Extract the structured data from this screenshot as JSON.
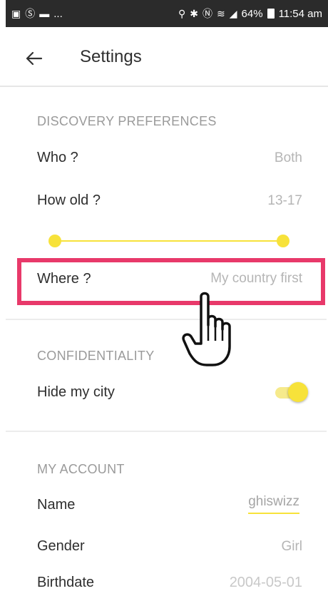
{
  "status_bar": {
    "left_text": "...",
    "battery": "64%",
    "time": "11:54 am"
  },
  "header": {
    "title": "Settings"
  },
  "discovery": {
    "section_title": "DISCOVERY PREFERENCES",
    "who_label": "Who ?",
    "who_value": "Both",
    "age_label": "How old ?",
    "age_value": "13-17",
    "where_label": "Where ?",
    "where_value": "My country first"
  },
  "confidentiality": {
    "section_title": "CONFIDENTIALITY",
    "hide_city_label": "Hide my city"
  },
  "account": {
    "section_title": "MY ACCOUNT",
    "name_label": "Name",
    "name_value": "ghiswizz",
    "gender_label": "Gender",
    "gender_value": "Girl",
    "birthdate_label": "Birthdate",
    "birthdate_value": "2004-05-01"
  },
  "colors": {
    "accent_yellow": "#f7e23a",
    "highlight_pink": "#e8396a",
    "status_bar_bg": "#2b2b2b"
  },
  "icons": [
    "back-arrow-icon",
    "cursor-hand-icon"
  ]
}
